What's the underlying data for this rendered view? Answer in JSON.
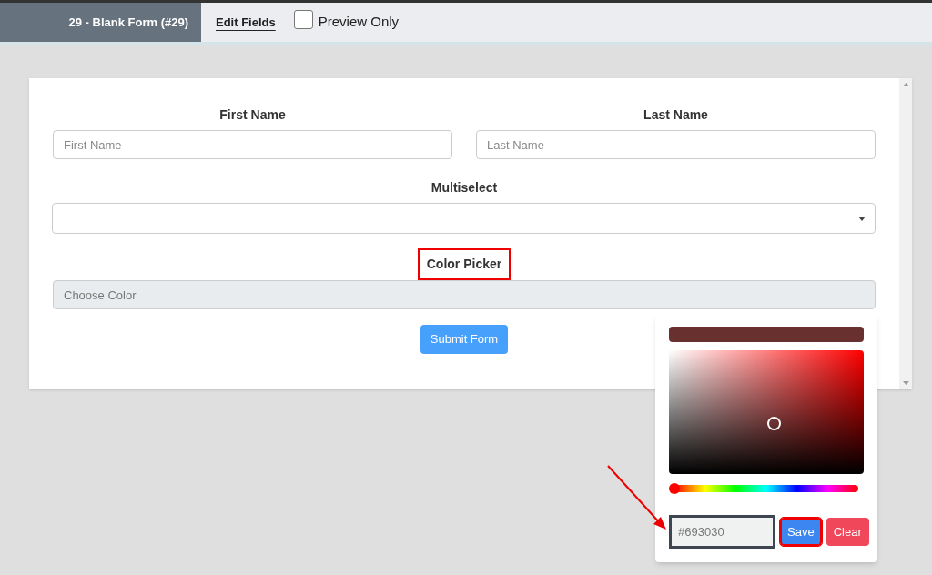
{
  "header": {
    "title": "29 - Blank Form (#29)",
    "edit_link": "Edit Fields",
    "preview": {
      "label": "Preview Only",
      "checked": false
    }
  },
  "form": {
    "fields": [
      {
        "label": "First Name",
        "placeholder": "First Name"
      },
      {
        "label": "Last Name",
        "placeholder": "Last Name"
      }
    ],
    "multiselect": {
      "label": "Multiselect"
    },
    "color_picker": {
      "label": "Color Picker",
      "placeholder": "Choose Color",
      "highlighted": true
    },
    "submit": "Submit Form"
  },
  "picker": {
    "color": "#693030",
    "hex_value": "#693030",
    "hue": {
      "level": 0
    },
    "buttons": [
      {
        "kind": "save",
        "label": "Save",
        "highlighted": true
      },
      {
        "kind": "clear",
        "label": "Clear",
        "highlighted": false
      }
    ]
  }
}
